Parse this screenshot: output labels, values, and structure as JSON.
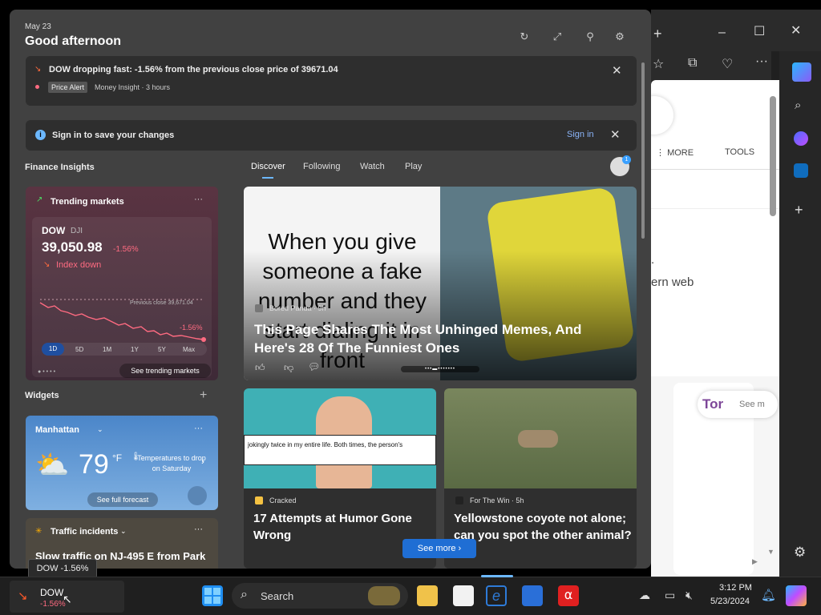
{
  "panel": {
    "date": "May 23",
    "greeting": "Good afternoon",
    "alert": {
      "title": "DOW dropping fast: -1.56% from the previous close price of 39671.04",
      "badge": "Price Alert",
      "source": "Money Insight · 3 hours"
    },
    "signin": {
      "text": "Sign in to save your changes",
      "button": "Sign in"
    },
    "finance_title": "Finance Insights",
    "tabs": [
      "Discover",
      "Following",
      "Watch",
      "Play"
    ],
    "markets": {
      "title": "Trending markets",
      "symbol": "DOW",
      "exchange": "DJI",
      "price": "39,050.98",
      "change": "-1.56%",
      "trend": "Index down",
      "prev_close_label": "Previous close 39,671.04",
      "chart_change": "-1.56%",
      "ranges": [
        "1D",
        "5D",
        "1M",
        "1Y",
        "5Y",
        "Max"
      ],
      "active_range": "1D",
      "see_more": "See trending markets",
      "more": "···"
    },
    "widgets_title": "Widgets",
    "weather": {
      "city": "Manhattan",
      "temp": "79",
      "unit": "°F",
      "note": "Temperatures to drop on Saturday",
      "link": "See full forecast"
    },
    "traffic": {
      "title": "Traffic incidents",
      "headline": "Slow traffic on NJ-495 E from Park"
    },
    "hero": {
      "source": "Bored Panda · 9h",
      "title": "This Page Shares The Most Unhinged Memes, And Here's 28 Of The Funniest Ones",
      "meme_text": "When you give someone a fake number and they start dialing it in front"
    },
    "card2": {
      "source": "Cracked",
      "title": "17 Attempts at Humor Gone Wrong",
      "image_caption": "jokingly twice in my entire life. Both times, the person's"
    },
    "card3": {
      "source": "For The Win · 5h",
      "title": "Yellowstone coyote not alone; can you spot the other animal?"
    },
    "see_more": "See more"
  },
  "browser": {
    "more": "MORE",
    "tools": "TOOLS",
    "partial1": ".",
    "partial2": "ern web",
    "tor_logo": "Tor",
    "tor_text": "See m"
  },
  "taskbar": {
    "ticker_name": "DOW",
    "ticker_change": "-1.56%",
    "tooltip": "DOW -1.56%",
    "search": "Search",
    "time": "3:12 PM",
    "date": "5/23/2024"
  },
  "colors": {
    "accent": "#1f6ed4",
    "negative": "#ff6b81",
    "link": "#8ab4f8"
  }
}
